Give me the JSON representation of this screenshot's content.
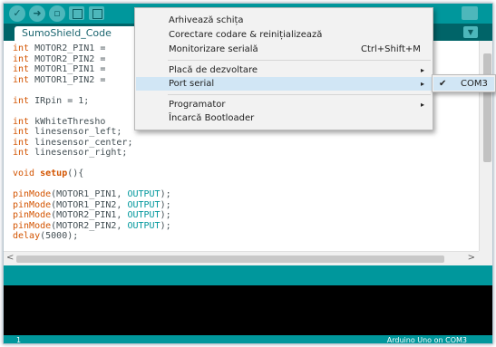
{
  "window": {
    "tab_title": "SumoShield_Code",
    "tab_menu_icon": "chevron-down-icon"
  },
  "code_lines": [
    [
      {
        "t": "int ",
        "c": "kw-type"
      },
      {
        "t": "MOTOR2_PIN1 ="
      }
    ],
    [
      {
        "t": "int ",
        "c": "kw-type"
      },
      {
        "t": "MOTOR2_PIN2 ="
      }
    ],
    [
      {
        "t": "int ",
        "c": "kw-type"
      },
      {
        "t": "MOTOR1_PIN1 ="
      }
    ],
    [
      {
        "t": "int ",
        "c": "kw-type"
      },
      {
        "t": "MOTOR1_PIN2 ="
      }
    ],
    [],
    [
      {
        "t": "int ",
        "c": "kw-type"
      },
      {
        "t": "IRpin = 1;"
      }
    ],
    [],
    [
      {
        "t": "int ",
        "c": "kw-type"
      },
      {
        "t": "kWhiteThresho"
      }
    ],
    [
      {
        "t": "int ",
        "c": "kw-type"
      },
      {
        "t": "linesensor_left;"
      }
    ],
    [
      {
        "t": "int ",
        "c": "kw-type"
      },
      {
        "t": "linesensor_center;"
      }
    ],
    [
      {
        "t": "int ",
        "c": "kw-type"
      },
      {
        "t": "linesensor_right;"
      }
    ],
    [],
    [
      {
        "t": "void ",
        "c": "kw-type"
      },
      {
        "t": "setup",
        "c": "kw-setup"
      },
      {
        "t": "(){"
      }
    ],
    [],
    [
      {
        "t": "pinMode",
        "c": "kw-fn"
      },
      {
        "t": "(MOTOR1_PIN1, "
      },
      {
        "t": "OUTPUT",
        "c": "kw-const"
      },
      {
        "t": ");"
      }
    ],
    [
      {
        "t": "pinMode",
        "c": "kw-fn"
      },
      {
        "t": "(MOTOR1_PIN2, "
      },
      {
        "t": "OUTPUT",
        "c": "kw-const"
      },
      {
        "t": ");"
      }
    ],
    [
      {
        "t": "pinMode",
        "c": "kw-fn"
      },
      {
        "t": "(MOTOR2_PIN1, "
      },
      {
        "t": "OUTPUT",
        "c": "kw-const"
      },
      {
        "t": ");"
      }
    ],
    [
      {
        "t": "pinMode",
        "c": "kw-fn"
      },
      {
        "t": "(MOTOR2_PIN2, "
      },
      {
        "t": "OUTPUT",
        "c": "kw-const"
      },
      {
        "t": ");"
      }
    ],
    [
      {
        "t": "delay",
        "c": "kw-fn"
      },
      {
        "t": "(5000);"
      }
    ]
  ],
  "menu": {
    "archive_sketch": "Arhivează schița",
    "fix_encoding": "Corectare codare & reinițializează",
    "serial_monitor": "Monitorizare serială",
    "serial_monitor_shortcut": "Ctrl+Shift+M",
    "board": "Placă de dezvoltare",
    "serial_port": "Port serial",
    "programmer": "Programator",
    "burn_bootloader": "Încarcă Bootloader",
    "submenu_arrow": "▸"
  },
  "submenu": {
    "check": "✔",
    "port": "COM3"
  },
  "footer": {
    "line_number": "1",
    "board_status": "Arduino Uno on COM3"
  }
}
